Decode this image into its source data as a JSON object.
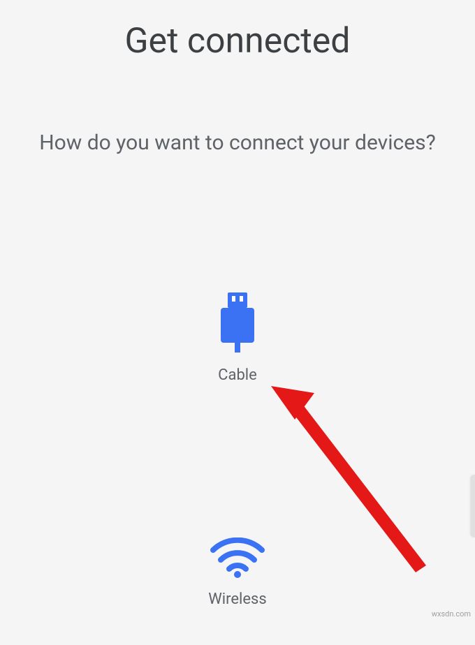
{
  "header": {
    "title": "Get connected",
    "subtitle": "How do you want to connect your devices?"
  },
  "options": {
    "cable": {
      "label": "Cable"
    },
    "wireless": {
      "label": "Wireless"
    }
  },
  "colors": {
    "accent": "#3a72f3",
    "annotation": "#e51818"
  },
  "watermark": "wxsdn.com"
}
